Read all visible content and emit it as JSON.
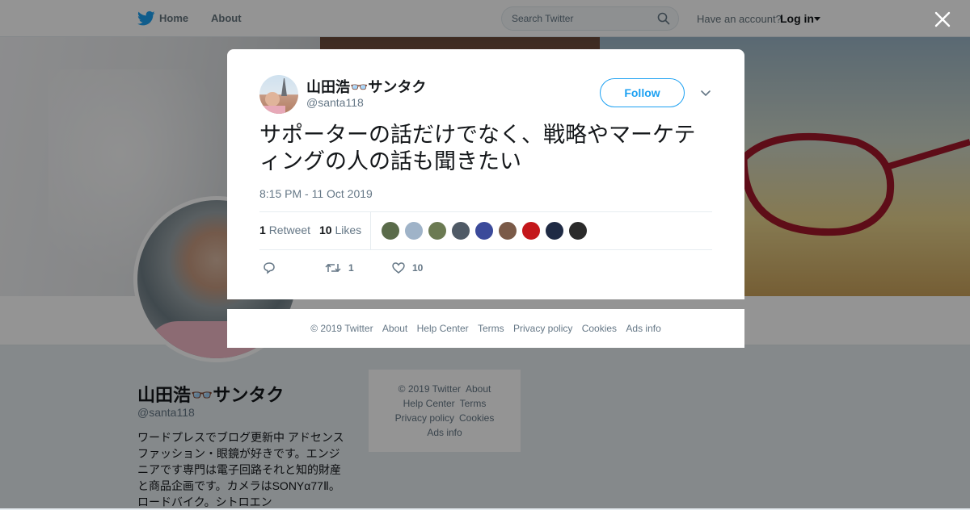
{
  "topnav": {
    "home_label": "Home",
    "about_label": "About",
    "search_placeholder": "Search Twitter",
    "have_account": "Have an account?",
    "login_label": "Log in"
  },
  "profile": {
    "name": "山田浩👓サンタク",
    "handle": "@santa118",
    "bio": "ワードプレスでブログ更新中 アドセンス　ファッション・眼鏡が好きです。エンジニアです専門は電子回路それと知的財産と商品企画です。カメラはSONYα77Ⅱ。ロードバイク。シトロエン"
  },
  "side_footer": {
    "copyright": "© 2019 Twitter",
    "about": "About",
    "help_center": "Help Center",
    "terms": "Terms",
    "privacy": "Privacy policy",
    "cookies": "Cookies",
    "ads_info": "Ads info"
  },
  "tweet": {
    "author_name": "山田浩👓サンタク",
    "author_handle": "@santa118",
    "follow_label": "Follow",
    "text": "サポーターの話だけでなく、戦略やマーケティングの人の話も聞きたい",
    "timestamp": "8:15 PM - 11 Oct 2019",
    "retweet_count": "1",
    "retweet_label": "Retweet",
    "like_count": "10",
    "like_label": "Likes",
    "action_retweet_count": "1",
    "action_like_count": "10",
    "liker_colors": [
      "#5a6b4a",
      "#9fb3c8",
      "#6b7a52",
      "#4f5a66",
      "#3b4a9a",
      "#7a5a48",
      "#c4171b",
      "#1f2a44",
      "#2a2a2a"
    ]
  },
  "modal_footer": {
    "copyright": "© 2019 Twitter",
    "about": "About",
    "help_center": "Help Center",
    "terms": "Terms",
    "privacy": "Privacy policy",
    "cookies": "Cookies",
    "ads_info": "Ads info"
  },
  "colors": {
    "brand": "#1da1f2",
    "text_primary": "#14171a",
    "text_secondary": "#657786"
  }
}
